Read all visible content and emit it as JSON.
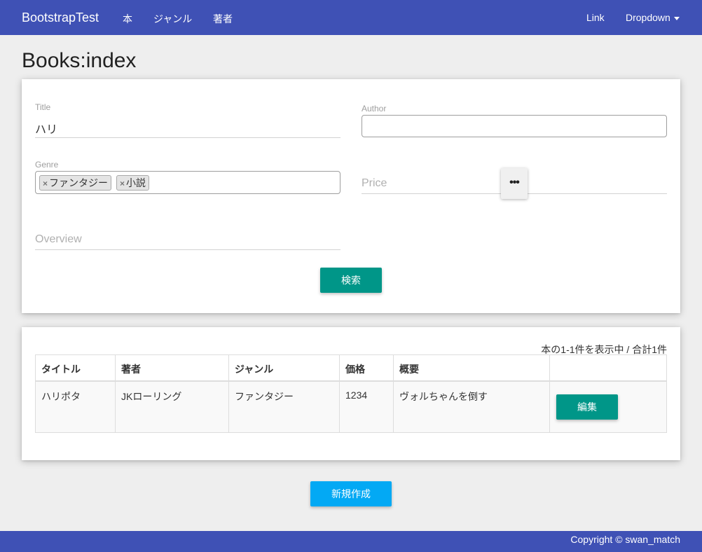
{
  "navbar": {
    "brand": "BootstrapTest",
    "links": [
      "本",
      "ジャンル",
      "著者"
    ],
    "right_link": "Link",
    "dropdown": "Dropdown"
  },
  "page": {
    "title": "Books:index"
  },
  "search_form": {
    "title": {
      "label": "Title",
      "value": "ハリ"
    },
    "author": {
      "label": "Author",
      "value": ""
    },
    "genre": {
      "label": "Genre",
      "tags": [
        "ファンタジー",
        "小説"
      ]
    },
    "price": {
      "placeholder": "Price"
    },
    "overview": {
      "placeholder": "Overview"
    },
    "search_button": "検索"
  },
  "results": {
    "count_text": "本の1-1件を表示中 / 合計1件",
    "headers": [
      "タイトル",
      "著者",
      "ジャンル",
      "価格",
      "概要",
      ""
    ],
    "rows": [
      {
        "title": "ハリポタ",
        "author": "JKローリング",
        "genre": "ファンタジー",
        "price": "1234",
        "overview": "ヴォルちゃんを倒す",
        "edit_label": "編集"
      }
    ]
  },
  "new_button": "新規作成",
  "footer": {
    "copyright": "Copyright © swan_match"
  },
  "colors": {
    "primary": "#3f51b5",
    "teal": "#009688",
    "light_blue": "#03a9f4",
    "background": "#eeeeee"
  }
}
